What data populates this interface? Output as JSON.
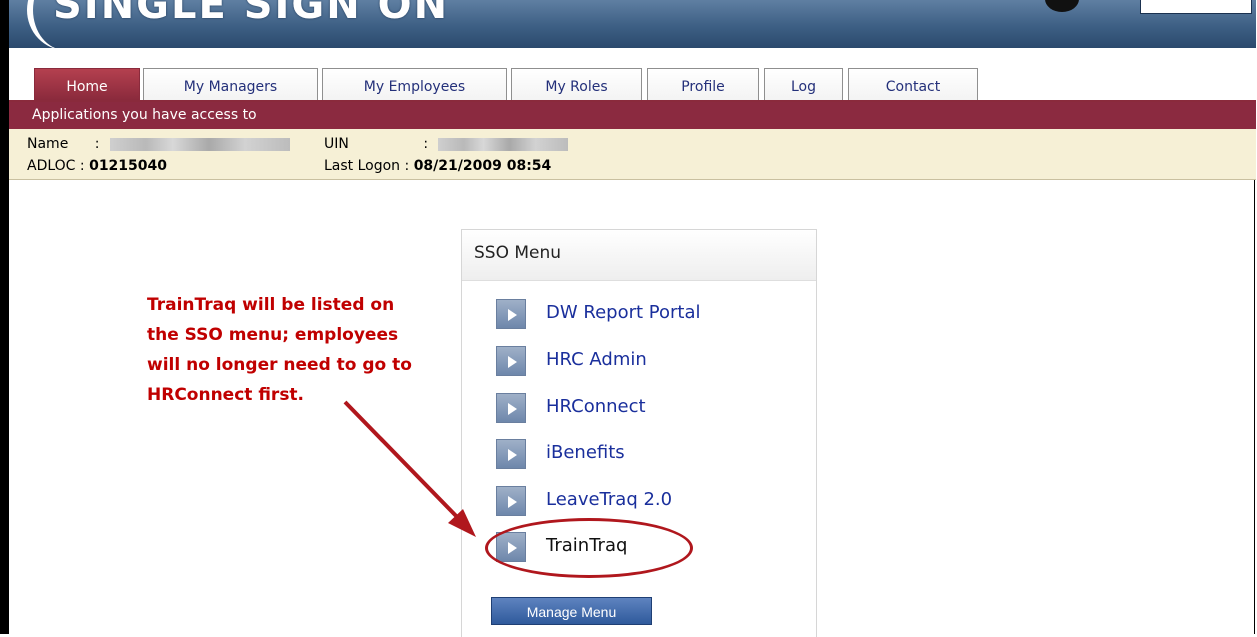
{
  "banner": {
    "logo_text": "SINGLE SIGN ON"
  },
  "tabs": [
    {
      "label": "Home",
      "active": true
    },
    {
      "label": "My Managers"
    },
    {
      "label": "My Employees"
    },
    {
      "label": "My Roles"
    },
    {
      "label": "Profile"
    },
    {
      "label": "Log"
    },
    {
      "label": "Contact"
    }
  ],
  "subbar": {
    "text": "Applications you have access to"
  },
  "user_info": {
    "name_label": "Name",
    "uin_label": "UIN",
    "adloc_label": "ADLOC",
    "adloc_value": "01215040",
    "last_logon_label": "Last Logon",
    "last_logon_value": "08/21/2009 08:54",
    "separator": ":"
  },
  "sso_menu": {
    "title": "SSO Menu",
    "items": [
      {
        "label": "DW Report Portal"
      },
      {
        "label": "HRC Admin"
      },
      {
        "label": "HRConnect"
      },
      {
        "label": "iBenefits"
      },
      {
        "label": "LeaveTraq 2.0"
      },
      {
        "label": "TrainTraq"
      }
    ],
    "manage_button": "Manage Menu"
  },
  "annotation": {
    "lines": [
      "TrainTraq will be listed on",
      "the SSO menu; employees",
      "will no longer need to go to",
      "HRConnect first."
    ],
    "color": "#c00000"
  }
}
